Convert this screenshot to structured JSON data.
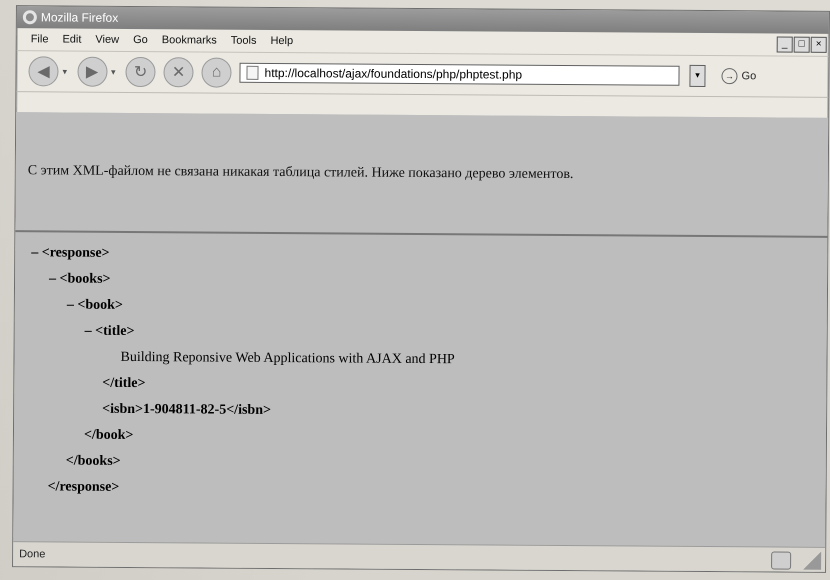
{
  "window": {
    "title": "Mozilla Firefox",
    "buttons": {
      "minimize": "_",
      "maximize": "□",
      "close": "×"
    }
  },
  "menu": [
    "File",
    "Edit",
    "View",
    "Go",
    "Bookmarks",
    "Tools",
    "Help"
  ],
  "toolbar": {
    "address": "http://localhost/ajax/foundations/php/phptest.php",
    "go_label": "Go",
    "icons": [
      "back-icon",
      "forward-icon",
      "reload-icon",
      "stop-icon",
      "home-icon"
    ]
  },
  "banner_text": "С этим XML-файлом не связана никакая таблица стилей. Ниже показано дерево элементов.",
  "xml_tree": [
    {
      "text": "– <response>",
      "indent": 0
    },
    {
      "text": "– <books>",
      "indent": 1
    },
    {
      "text": "– <book>",
      "indent": 2
    },
    {
      "text": "– <title>",
      "indent": 3
    },
    {
      "text": "Building Reponsive Web Applications with AJAX and PHP",
      "indent": 5
    },
    {
      "text": "</title>",
      "indent": 4
    },
    {
      "text": "<isbn>1-904811-82-5</isbn>",
      "indent": 4
    },
    {
      "text": "</book>",
      "indent": 3
    },
    {
      "text": "</books>",
      "indent": 2
    },
    {
      "text": "</response>",
      "indent": 1
    }
  ],
  "status": "Done"
}
